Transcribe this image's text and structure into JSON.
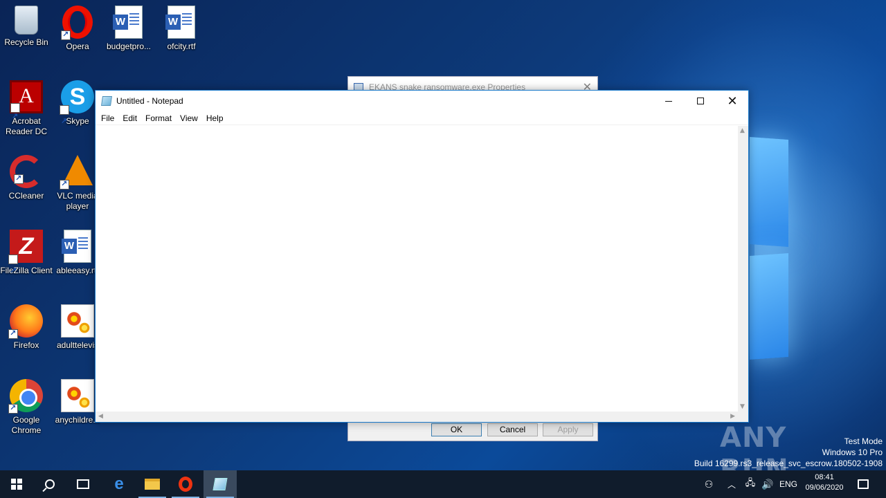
{
  "desktop": {
    "icons": [
      {
        "label": "Recycle Bin"
      },
      {
        "label": "Opera"
      },
      {
        "label": "budgetpro..."
      },
      {
        "label": "ofcity.rtf"
      },
      {
        "label": "Acrobat Reader DC"
      },
      {
        "label": "Skype"
      },
      {
        "label": "CCleaner"
      },
      {
        "label": "VLC media player"
      },
      {
        "label": "FileZilla Client"
      },
      {
        "label": "ableeasy.rtf"
      },
      {
        "label": "Firefox"
      },
      {
        "label": "adulttelevis"
      },
      {
        "label": "Google Chrome"
      },
      {
        "label": "anychildre..."
      }
    ]
  },
  "properties_dialog": {
    "title": "EKANS snake ransomware.exe Properties",
    "ok_label": "OK",
    "cancel_label": "Cancel",
    "apply_label": "Apply"
  },
  "notepad": {
    "title": "Untitled - Notepad",
    "menu": [
      "File",
      "Edit",
      "Format",
      "View",
      "Help"
    ],
    "content": ""
  },
  "watermark": {
    "text": "ANY RUN",
    "mode_line1": "Test Mode",
    "mode_line2": "Windows 10 Pro",
    "build": "Build 16299.rs3_release_svc_escrow.180502-1908"
  },
  "taskbar": {
    "language": "ENG",
    "time": "08:41",
    "date": "09/06/2020"
  },
  "colors": {
    "accent": "#1979ca",
    "taskbar": "#101c2c"
  }
}
